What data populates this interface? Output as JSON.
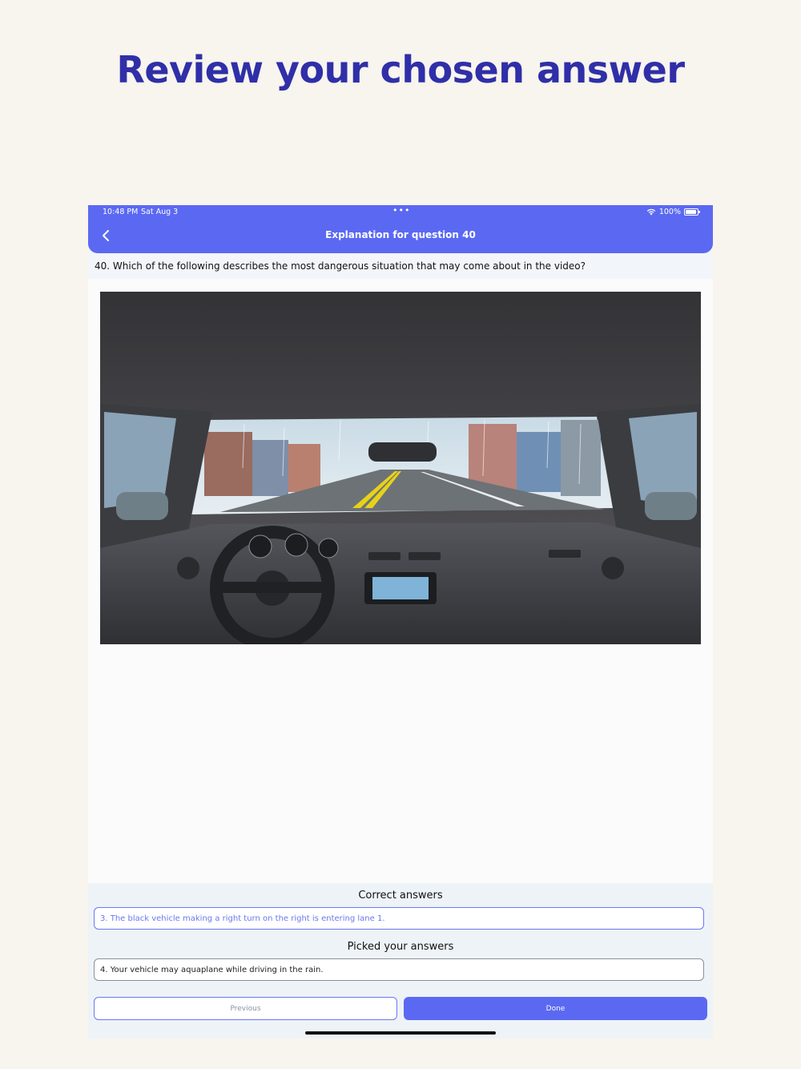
{
  "headline": "Review your chosen answer",
  "status_bar": {
    "time": "10:48 PM",
    "date": "Sat Aug 3",
    "dots": "•••",
    "battery": "100%"
  },
  "nav": {
    "title": "Explanation for question 40",
    "back_icon": "chevron-left-icon"
  },
  "question": {
    "text": "40. Which of the following describes the most dangerous situation that may come about in the video?"
  },
  "correct": {
    "title": "Correct answers",
    "answer": "3. The black vehicle making a right turn on the right is entering lane 1."
  },
  "picked": {
    "title": "Picked your answers",
    "answer": "4. Your vehicle may aquaplane while driving in the rain."
  },
  "buttons": {
    "previous": "Previous",
    "done": "Done"
  },
  "colors": {
    "accent": "#5b69f2",
    "headline": "#2f2fa8",
    "correct_text": "#6a78f0",
    "background": "#f8f4ee"
  }
}
